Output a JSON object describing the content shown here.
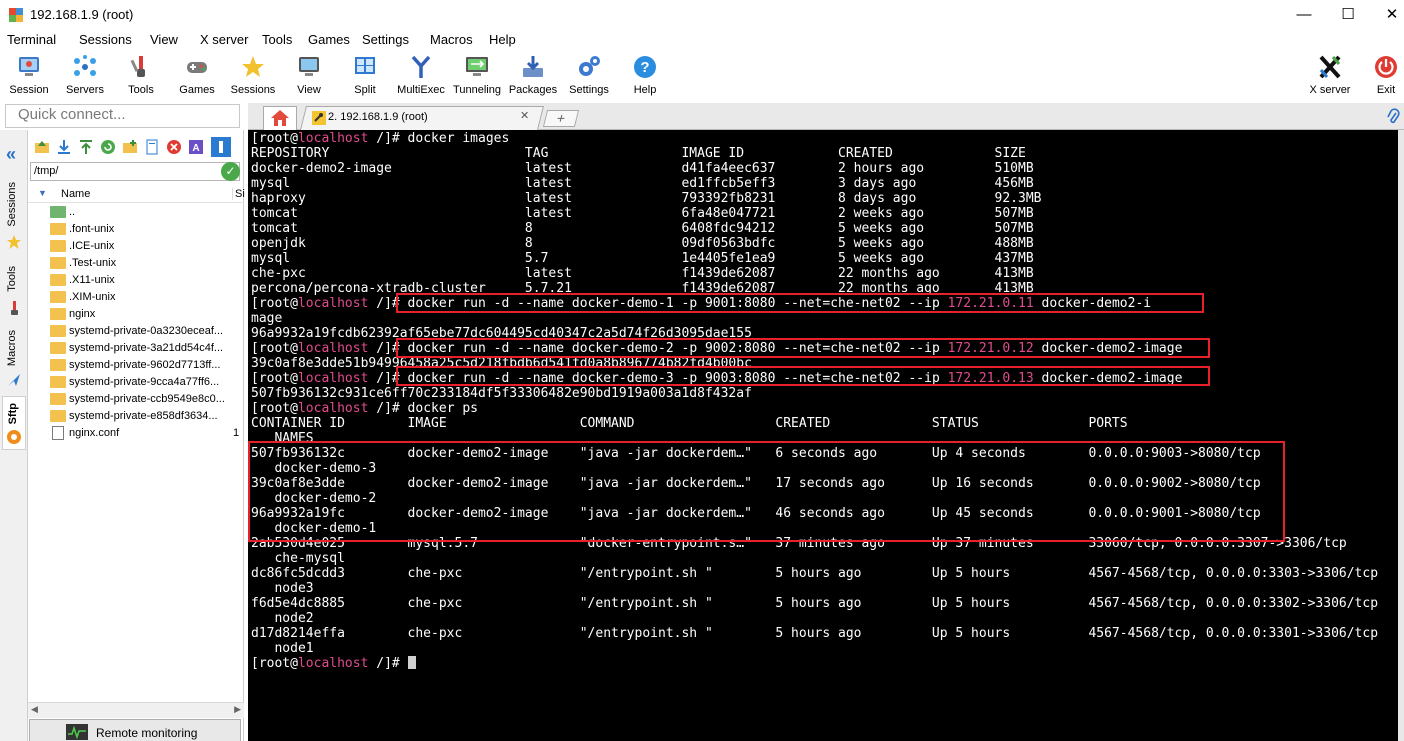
{
  "window": {
    "title": "192.168.1.9 (root)"
  },
  "menu": [
    "Terminal",
    "Sessions",
    "View",
    "X server",
    "Tools",
    "Games",
    "Settings",
    "Macros",
    "Help"
  ],
  "toolbar": {
    "session": "Session",
    "servers": "Servers",
    "tools": "Tools",
    "games": "Games",
    "sessions": "Sessions",
    "view": "View",
    "split": "Split",
    "multiexec": "MultiExec",
    "tunneling": "Tunneling",
    "packages": "Packages",
    "settings": "Settings",
    "help": "Help",
    "xserver": "X server",
    "exit": "Exit"
  },
  "quick_connect": {
    "placeholder": "Quick connect..."
  },
  "tabs": {
    "session_tab": "2. 192.168.1.9 (root)"
  },
  "side_tabs": [
    "Sessions",
    "Tools",
    "Macros",
    "Sftp"
  ],
  "sftp": {
    "path": "/tmp/",
    "column_name": "Name",
    "column_size": "Si",
    "files": [
      {
        "name": "..",
        "kind": "up",
        "size": ""
      },
      {
        "name": ".font-unix",
        "kind": "folder",
        "size": ""
      },
      {
        "name": ".ICE-unix",
        "kind": "folder",
        "size": ""
      },
      {
        "name": ".Test-unix",
        "kind": "folder",
        "size": ""
      },
      {
        "name": ".X11-unix",
        "kind": "folder",
        "size": ""
      },
      {
        "name": ".XIM-unix",
        "kind": "folder",
        "size": ""
      },
      {
        "name": "nginx",
        "kind": "folder",
        "size": ""
      },
      {
        "name": "systemd-private-0a3230eceaf...",
        "kind": "folder",
        "size": ""
      },
      {
        "name": "systemd-private-3a21dd54c4f...",
        "kind": "folder",
        "size": ""
      },
      {
        "name": "systemd-private-9602d7713ff...",
        "kind": "folder",
        "size": ""
      },
      {
        "name": "systemd-private-9cca4a77ff6...",
        "kind": "folder",
        "size": ""
      },
      {
        "name": "systemd-private-ccb9549e8c0...",
        "kind": "folder",
        "size": ""
      },
      {
        "name": "systemd-private-e858df3634...",
        "kind": "folder",
        "size": ""
      },
      {
        "name": "nginx.conf",
        "kind": "file",
        "size": "1"
      }
    ],
    "remote_monitoring": "Remote monitoring"
  },
  "terminal": {
    "lines": [
      [
        {
          "t": "[root@"
        },
        {
          "t": "localhost",
          "c": "host"
        },
        {
          "t": " /]# docker images"
        }
      ],
      [
        {
          "t": "REPOSITORY                         TAG                 IMAGE ID            CREATED             SIZE"
        }
      ],
      [
        {
          "t": "docker-demo2-image                 latest              d41fa4eec637        2 hours ago         510MB"
        }
      ],
      [
        {
          "t": "mysql                              latest              ed1ffcb5eff3        3 days ago          456MB"
        }
      ],
      [
        {
          "t": "haproxy                            latest              793392fb8231        8 days ago          92.3MB"
        }
      ],
      [
        {
          "t": "tomcat                             latest              6fa48e047721        2 weeks ago         507MB"
        }
      ],
      [
        {
          "t": "tomcat                             8                   6408fdc94212        5 weeks ago         507MB"
        }
      ],
      [
        {
          "t": "openjdk                            8                   09df0563bdfc        5 weeks ago         488MB"
        }
      ],
      [
        {
          "t": "mysql                              5.7                 1e4405fe1ea9        5 weeks ago         437MB"
        }
      ],
      [
        {
          "t": "che-pxc                            latest              f1439de62087        22 months ago       413MB"
        }
      ],
      [
        {
          "t": "percona/percona-xtradb-cluster     5.7.21              f1439de62087        22 months ago       413MB"
        }
      ],
      [
        {
          "t": "[root@"
        },
        {
          "t": "localhost",
          "c": "host"
        },
        {
          "t": " /]# docker run -d --name docker-demo-1 -p 9001:8080 --net=che-net02 --ip "
        },
        {
          "t": "172.21.0.11",
          "c": "ip"
        },
        {
          "t": " docker-demo2-i"
        }
      ],
      [
        {
          "t": "mage"
        }
      ],
      [
        {
          "t": "96a9932a19fcdb62392af65ebe77dc604495cd40347c2a5d74f26d3095dae155"
        }
      ],
      [
        {
          "t": "[root@"
        },
        {
          "t": "localhost",
          "c": "host"
        },
        {
          "t": " /]# docker run -d --name docker-demo-2 -p 9002:8080 --net=che-net02 --ip "
        },
        {
          "t": "172.21.0.12",
          "c": "ip"
        },
        {
          "t": " docker-demo2-image"
        }
      ],
      [
        {
          "t": "39c0af8e3dde51b94996458a25c5d218fbdb6d541fd0a8b896774b82fd4b00bc"
        }
      ],
      [
        {
          "t": "[root@"
        },
        {
          "t": "localhost",
          "c": "host"
        },
        {
          "t": " /]# docker run -d --name docker-demo-3 -p 9003:8080 --net=che-net02 --ip "
        },
        {
          "t": "172.21.0.13",
          "c": "ip"
        },
        {
          "t": " docker-demo2-image"
        }
      ],
      [
        {
          "t": "507fb936132c931ce6ff70c233184df5f33306482e90bd1919a003a1d8f432af"
        }
      ],
      [
        {
          "t": "[root@"
        },
        {
          "t": "localhost",
          "c": "host"
        },
        {
          "t": " /]# docker ps"
        }
      ],
      [
        {
          "t": "CONTAINER ID        IMAGE                 COMMAND                  CREATED             STATUS              PORTS"
        }
      ],
      [
        {
          "t": "   NAMES"
        }
      ],
      [
        {
          "t": "507fb936132c        docker-demo2-image    \"java -jar dockerdem…\"   6 seconds ago       Up 4 seconds        0.0.0.0:9003->8080/tcp"
        }
      ],
      [
        {
          "t": "   docker-demo-3"
        }
      ],
      [
        {
          "t": "39c0af8e3dde        docker-demo2-image    \"java -jar dockerdem…\"   17 seconds ago      Up 16 seconds       0.0.0.0:9002->8080/tcp"
        }
      ],
      [
        {
          "t": "   docker-demo-2"
        }
      ],
      [
        {
          "t": "96a9932a19fc        docker-demo2-image    \"java -jar dockerdem…\"   46 seconds ago      Up 45 seconds       0.0.0.0:9001->8080/tcp"
        }
      ],
      [
        {
          "t": "   docker-demo-1"
        }
      ],
      [
        {
          "t": "2ab530d4e025        mysql:5.7             \"docker-entrypoint.s…\"   37 minutes ago      Up 37 minutes       33060/tcp, 0.0.0.0:3307->3306/tcp"
        }
      ],
      [
        {
          "t": "   che-mysql"
        }
      ],
      [
        {
          "t": "dc86fc5dcdd3        che-pxc               \"/entrypoint.sh \"        5 hours ago         Up 5 hours          4567-4568/tcp, 0.0.0.0:3303->3306/tcp"
        }
      ],
      [
        {
          "t": "   node3"
        }
      ],
      [
        {
          "t": "f6d5e4dc8885        che-pxc               \"/entrypoint.sh \"        5 hours ago         Up 5 hours          4567-4568/tcp, 0.0.0.0:3302->3306/tcp"
        }
      ],
      [
        {
          "t": "   node2"
        }
      ],
      [
        {
          "t": "d17d8214effa        che-pxc               \"/entrypoint.sh \"        5 hours ago         Up 5 hours          4567-4568/tcp, 0.0.0.0:3301->3306/tcp"
        }
      ],
      [
        {
          "t": "   node1"
        }
      ],
      [
        {
          "t": "[root@"
        },
        {
          "t": "localhost",
          "c": "host"
        },
        {
          "t": " /]# "
        }
      ]
    ]
  },
  "colors": {
    "highlight_box": "#e8202a",
    "host": "#e14c8f",
    "terminal_bg": "#000000"
  }
}
